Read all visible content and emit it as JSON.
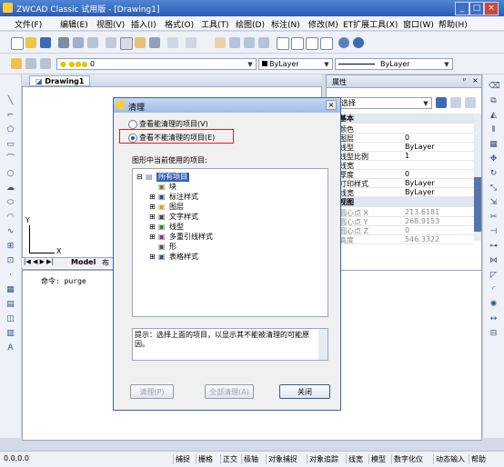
{
  "app": {
    "title": "ZWCAD Classic 试用版 - [Drawing1]"
  },
  "menu": [
    "文件(F)",
    "编辑(E)",
    "视图(V)",
    "插入(I)",
    "格式(O)",
    "工具(T)",
    "绘图(D)",
    "标注(N)",
    "修改(M)",
    "ET扩展工具(X)",
    "窗口(W)",
    "帮助(H)"
  ],
  "toolbar2": {
    "layer_value": "0",
    "color_value": "ByLayer",
    "linetype_value": "ByLayer"
  },
  "drawing": {
    "tab_label": "Drawing1",
    "model_tab": "Model",
    "layout_tab_partial": "布",
    "axis_y": "Y",
    "axis_x": "X"
  },
  "properties": {
    "title": "属性",
    "header": "无选择",
    "section_general": "基本",
    "rows": [
      {
        "label": "颜色",
        "value": ""
      },
      {
        "label": "图层",
        "value": "0"
      },
      {
        "label": "线型",
        "value": "ByLayer"
      },
      {
        "label": "线型比例",
        "value": "1"
      },
      {
        "label": "线宽",
        "value": ""
      },
      {
        "label": "厚度",
        "value": "0"
      },
      {
        "label": "打印样式",
        "value": "ByLayer"
      },
      {
        "label": "线宽",
        "value": "ByLayer"
      }
    ],
    "section_view": "视图",
    "view_rows": [
      {
        "label": "圆心点 X",
        "value": "213.6181"
      },
      {
        "label": "圆心点 Y",
        "value": "268.9153"
      },
      {
        "label": "圆心点 Z",
        "value": "0"
      },
      {
        "label": "高度",
        "value": "546.3322"
      }
    ]
  },
  "command": {
    "line": "命令: purge"
  },
  "dialog": {
    "title": "清理",
    "radio1": "查看能清理的项目(V)",
    "radio2": "查看不能清理的项目(E)",
    "group_label": "图形中当前使用的项目:",
    "tree_root": "所有项目",
    "tree_items": [
      "块",
      "标注样式",
      "图层",
      "文字样式",
      "线型",
      "多重引线样式",
      "形",
      "表格样式"
    ],
    "hint": "提示：选择上面的项目，以显示其不能被清理的可能原因。",
    "btn_purge": "清理(P)",
    "btn_purge_all": "全部清理(A)",
    "btn_close": "关闭"
  },
  "status": {
    "coords": "0.0,0.0",
    "items": [
      "捕捉",
      "栅格",
      "正交",
      "极轴",
      "对象捕捉",
      "对象追踪",
      "线宽",
      "模型",
      "数字化仪",
      "动态输入",
      "帮助"
    ]
  }
}
